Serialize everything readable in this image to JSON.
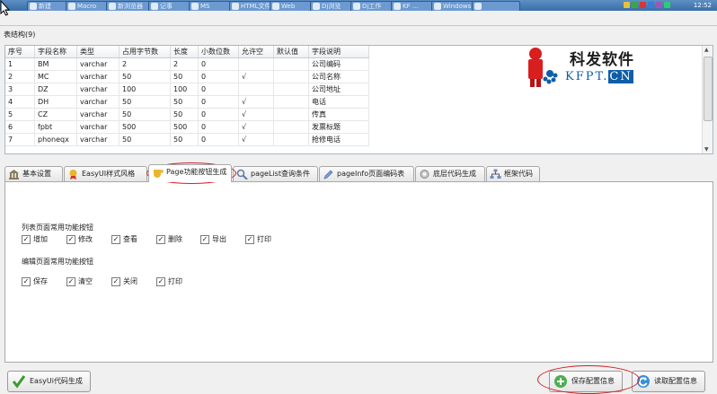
{
  "taskbar": {
    "items": [
      "新建",
      "Macro",
      "新浏览器",
      "记事",
      "MS",
      "HTML文件",
      "Web",
      "Dj浏览",
      "Dj工作",
      "KF ...",
      "Windows",
      ""
    ],
    "clock": "12:52",
    "tray_colors": [
      "#e8c13a",
      "#3aa640",
      "#d33",
      "#3a7bd5",
      "#9b59b6",
      "#2ecc71"
    ]
  },
  "table_group": {
    "title": "表结构(9)"
  },
  "grid": {
    "columns": [
      "序号",
      "字段名称",
      "类型",
      "占用字节数",
      "长度",
      "小数位数",
      "允许空",
      "默认值",
      "字段说明"
    ],
    "rows": [
      [
        "1",
        "BM",
        "varchar",
        "2",
        "2",
        "0",
        "",
        "",
        "公司编码"
      ],
      [
        "2",
        "MC",
        "varchar",
        "50",
        "50",
        "0",
        "√",
        "",
        "公司名称"
      ],
      [
        "3",
        "DZ",
        "varchar",
        "100",
        "100",
        "0",
        "",
        "",
        "公司地址"
      ],
      [
        "4",
        "DH",
        "varchar",
        "50",
        "50",
        "0",
        "√",
        "",
        "电话"
      ],
      [
        "5",
        "CZ",
        "varchar",
        "50",
        "50",
        "0",
        "√",
        "",
        "传真"
      ],
      [
        "6",
        "fpbt",
        "varchar",
        "500",
        "500",
        "0",
        "√",
        "",
        "发票标题"
      ],
      [
        "7",
        "phoneqx",
        "varchar",
        "50",
        "50",
        "0",
        "√",
        "",
        "抢修电话"
      ]
    ]
  },
  "logo": {
    "brand": "科发软件",
    "url_main": "KFPT",
    "url_dot": ".",
    "url_cn": "CN"
  },
  "tabs": [
    {
      "label": "基本设置",
      "icon": "bank-icon"
    },
    {
      "label": "EasyUI样式风格",
      "icon": "award-icon"
    },
    {
      "label": "Page功能按钮生成",
      "icon": "cup-icon"
    },
    {
      "label": "pageList查询条件",
      "icon": "magnifier-icon"
    },
    {
      "label": "pageInfo页面编码表",
      "icon": "pencil-icon"
    },
    {
      "label": "底层代码生成",
      "icon": "gear-icon"
    },
    {
      "label": "框架代码",
      "icon": "network-icon"
    }
  ],
  "active_tab": 2,
  "list_section": {
    "title": "列表页面常用功能按钮",
    "options": [
      {
        "label": "增加",
        "checked": true
      },
      {
        "label": "修改",
        "checked": true
      },
      {
        "label": "查看",
        "checked": true
      },
      {
        "label": "删除",
        "checked": true
      },
      {
        "label": "导出",
        "checked": true
      },
      {
        "label": "打印",
        "checked": true
      }
    ]
  },
  "edit_section": {
    "title": "编辑页面常用功能按钮",
    "options": [
      {
        "label": "保存",
        "checked": true
      },
      {
        "label": "清空",
        "checked": true
      },
      {
        "label": "关闭",
        "checked": true
      },
      {
        "label": "打印",
        "checked": true
      }
    ]
  },
  "buttons": {
    "generate": "EasyUi代码生成",
    "save_config": "保存配置信息",
    "read_config": "读取配置信息"
  },
  "colors": {
    "highlight_ellipse": "#d21d1d",
    "logo_red": "#d81e1e",
    "logo_blue": "#0d5ea8"
  }
}
